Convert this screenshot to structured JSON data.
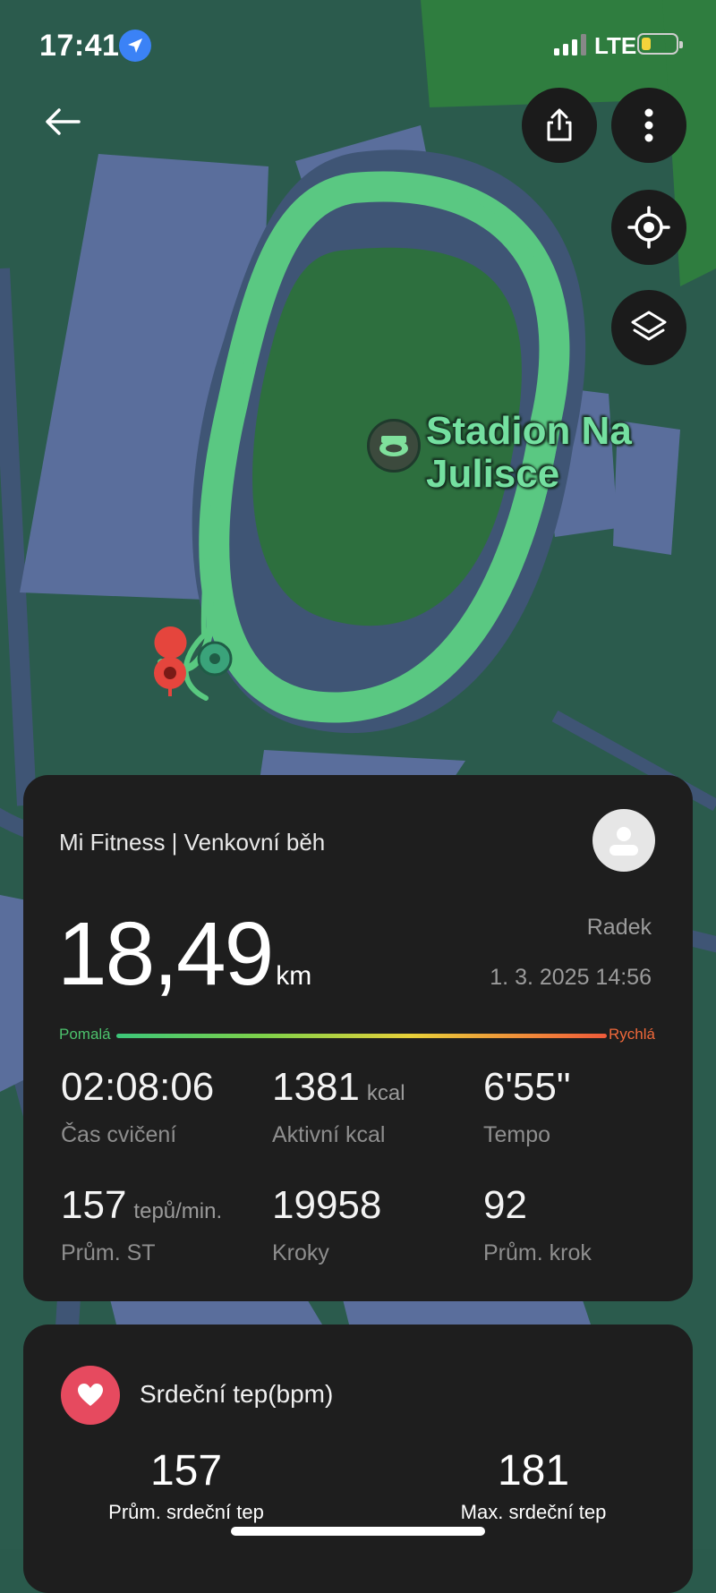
{
  "status_bar": {
    "time": "17:41",
    "network": "LTE"
  },
  "map": {
    "place_name_line1": "Stadion Na",
    "place_name_line2": "Julisce",
    "route_color": "#5ccf83",
    "start_marker_color": "#e5453d",
    "end_marker_color": "#3aa37a"
  },
  "toolbar": {
    "back_icon": "arrow-left-icon",
    "share_icon": "share-icon",
    "more_icon": "more-vertical-icon",
    "locate_icon": "crosshair-icon",
    "layers_icon": "layers-icon"
  },
  "summary": {
    "app_title": "Mi Fitness | Venkovní běh",
    "distance_value": "18,49",
    "distance_unit": "km",
    "user_name": "Radek",
    "datetime": "1. 3. 2025 14:56",
    "speed_slow": "Pomalá",
    "speed_fast": "Rychlá",
    "stats": [
      {
        "value": "02:08:06",
        "unit": "",
        "label": "Čas cvičení"
      },
      {
        "value": "1381",
        "unit": "kcal",
        "label": "Aktivní kcal"
      },
      {
        "value": "6'55\"",
        "unit": "",
        "label": "Tempo"
      },
      {
        "value": "157",
        "unit": "tepů/min.",
        "label": "Prům. ST"
      },
      {
        "value": "19958",
        "unit": "",
        "label": "Kroky"
      },
      {
        "value": "92",
        "unit": "",
        "label": "Prům. krok"
      }
    ]
  },
  "heart_rate": {
    "title": "Srdeční tep(bpm)",
    "avg_value": "157",
    "avg_label": "Prům. srdeční tep",
    "max_value": "181",
    "max_label": "Max. srdeční tep",
    "accent_color": "#e64a5f"
  }
}
